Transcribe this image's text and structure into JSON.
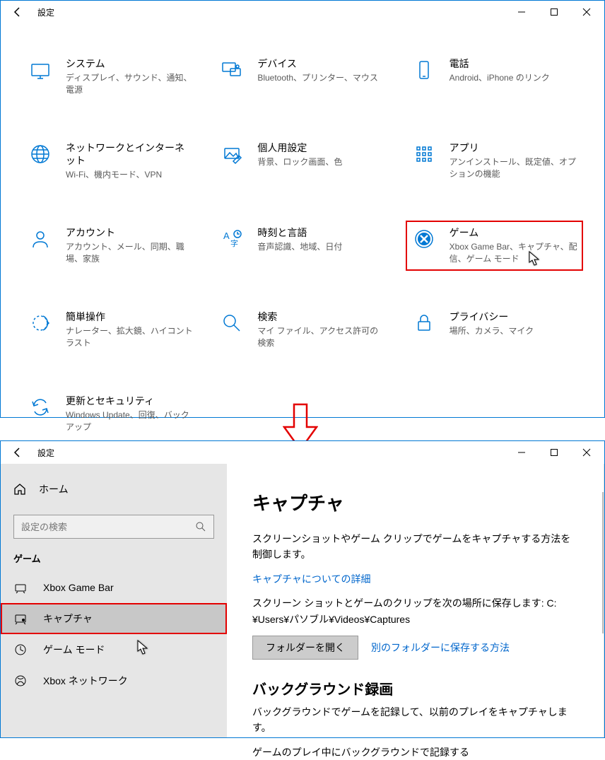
{
  "top": {
    "title": "設定",
    "tiles": [
      {
        "title": "システム",
        "desc": "ディスプレイ、サウンド、通知、電源",
        "icon": "system"
      },
      {
        "title": "デバイス",
        "desc": "Bluetooth、プリンター、マウス",
        "icon": "devices"
      },
      {
        "title": "電話",
        "desc": "Android、iPhone のリンク",
        "icon": "phone"
      },
      {
        "title": "ネットワークとインターネット",
        "desc": "Wi-Fi、機内モード、VPN",
        "icon": "network"
      },
      {
        "title": "個人用設定",
        "desc": "背景、ロック画面、色",
        "icon": "personalize"
      },
      {
        "title": "アプリ",
        "desc": "アンインストール、既定値、オプションの機能",
        "icon": "apps"
      },
      {
        "title": "アカウント",
        "desc": "アカウント、メール、同期、職場、家族",
        "icon": "account"
      },
      {
        "title": "時刻と言語",
        "desc": "音声認識、地域、日付",
        "icon": "time"
      },
      {
        "title": "ゲーム",
        "desc": "Xbox Game Bar、キャプチャ、配信、ゲーム モード",
        "icon": "gaming",
        "highlight": true
      },
      {
        "title": "簡単操作",
        "desc": "ナレーター、拡大鏡、ハイコントラスト",
        "icon": "ease"
      },
      {
        "title": "検索",
        "desc": "マイ ファイル、アクセス許可の検索",
        "icon": "search"
      },
      {
        "title": "プライバシー",
        "desc": "場所、カメラ、マイク",
        "icon": "privacy"
      },
      {
        "title": "更新とセキュリティ",
        "desc": "Windows Update、回復、バックアップ",
        "icon": "update"
      }
    ]
  },
  "bottom": {
    "title": "設定",
    "home": "ホーム",
    "search_placeholder": "設定の検索",
    "section": "ゲーム",
    "nav": [
      {
        "label": "Xbox Game Bar",
        "icon": "gamebar"
      },
      {
        "label": "キャプチャ",
        "icon": "capture",
        "selected": true
      },
      {
        "label": "ゲーム モード",
        "icon": "gamemode"
      },
      {
        "label": "Xbox ネットワーク",
        "icon": "xbox"
      }
    ],
    "content": {
      "h1": "キャプチャ",
      "p1": "スクリーンショットやゲーム クリップでゲームをキャプチャする方法を制御します。",
      "link1": "キャプチャについての詳細",
      "p2": "スクリーン ショットとゲームのクリップを次の場所に保存します: C:¥Users¥パソブル¥Videos¥Captures",
      "button": "フォルダーを開く",
      "link2": "別のフォルダーに保存する方法",
      "h2": "バックグラウンド録画",
      "p3": "バックグラウンドでゲームを記録して、以前のプレイをキャプチャします。",
      "p4": "ゲームのプレイ中にバックグラウンドで記録する"
    }
  }
}
